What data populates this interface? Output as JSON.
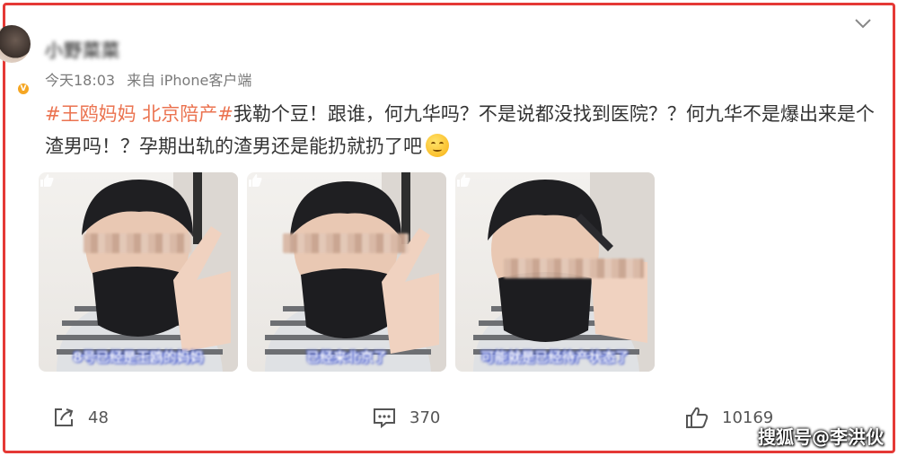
{
  "post": {
    "username": "小野菜菜",
    "time": "今天18:03",
    "source": "来自 iPhone客户端",
    "tag1": "#王鸥妈妈 北京陪产#",
    "body": "我勒个豆！跟谁，何九华吗？不是说都没找到医院？？何九华不是爆出来是个渣男吗！？孕期出轨的渣男还是能扔就扔了吧"
  },
  "images": [
    {
      "caption": "8号已经是王鸥的妈妈"
    },
    {
      "caption": "已经来北京了"
    },
    {
      "caption": "可能就是已经待产状态了"
    }
  ],
  "actions": {
    "share_count": "48",
    "comment_count": "370",
    "like_count": "10169"
  },
  "watermark": "搜狐号@李洪伙",
  "colors": {
    "frame": "#e53935",
    "tag": "#eb7350"
  }
}
